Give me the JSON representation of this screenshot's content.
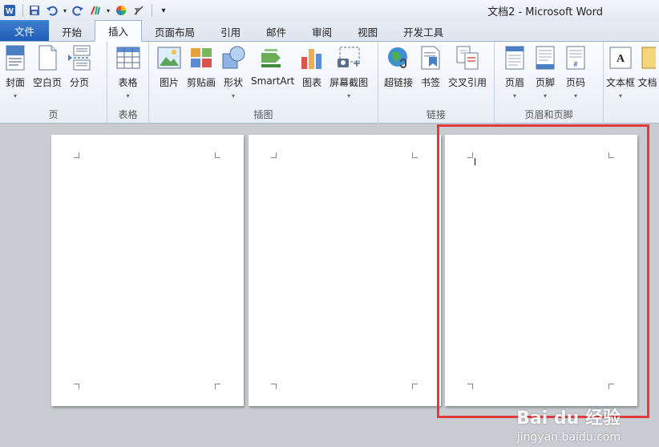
{
  "window": {
    "title": "文档2  -  Microsoft Word"
  },
  "quick_access": [
    "word-icon",
    "save-icon",
    "undo-icon",
    "redo-icon",
    "format-painter-icon",
    "color-icon",
    "clear-format-icon",
    "customize-icon"
  ],
  "tabs": [
    "文件",
    "开始",
    "插入",
    "页面布局",
    "引用",
    "邮件",
    "审阅",
    "视图",
    "开发工具"
  ],
  "active_tab": "插入",
  "ribbon": {
    "pages": {
      "label": "页",
      "buttons": [
        "封面",
        "空白页",
        "分页"
      ]
    },
    "tables": {
      "label": "表格",
      "buttons": [
        "表格"
      ]
    },
    "illustrations": {
      "label": "插图",
      "buttons": [
        "图片",
        "剪贴画",
        "形状",
        "SmartArt",
        "图表",
        "屏幕截图"
      ]
    },
    "links": {
      "label": "链接",
      "buttons": [
        "超链接",
        "书签",
        "交叉引用"
      ]
    },
    "header_footer": {
      "label": "页眉和页脚",
      "buttons": [
        "页眉",
        "页脚",
        "页码"
      ]
    },
    "text": {
      "buttons": [
        "文本框",
        "文档"
      ]
    }
  },
  "watermark": {
    "brand": "Bai du 经验",
    "url": "jingyan.baidu.com"
  },
  "colors": {
    "file_tab": "#2a6cc4",
    "highlight": "#e23b3b",
    "background": "#c9ccd1"
  }
}
